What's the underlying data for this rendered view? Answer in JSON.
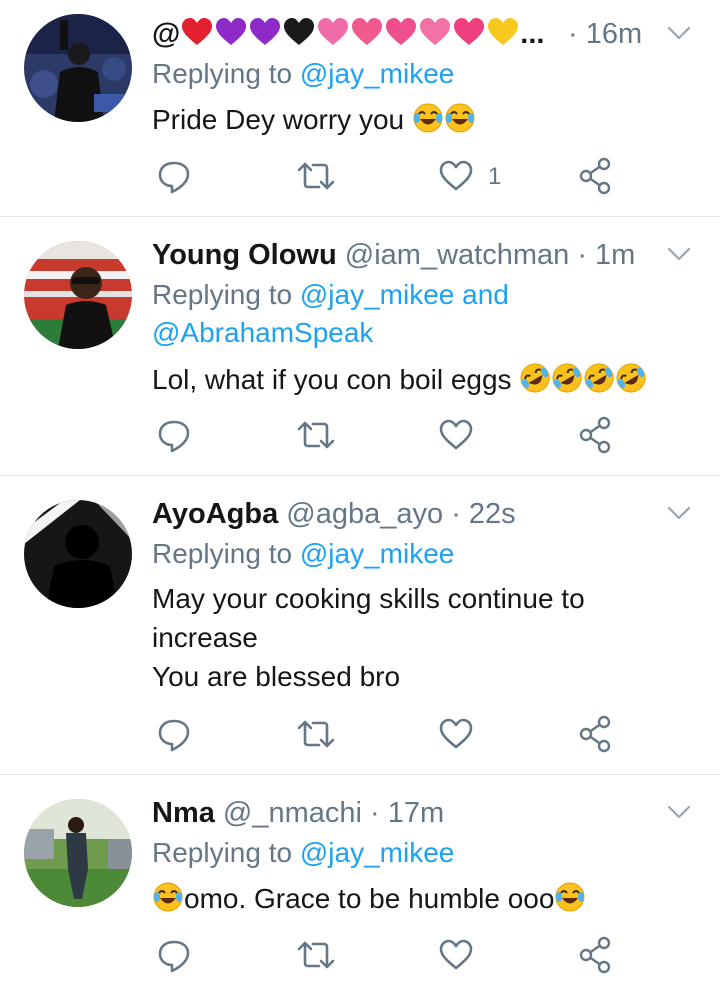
{
  "tweets": [
    {
      "name": "@",
      "handle": "",
      "time": "· 16m",
      "name_emojis": [
        "red-heart",
        "purple-heart",
        "purple-heart",
        "black-heart",
        "sparkling-heart",
        "heart-with-ribbon",
        "two-hearts",
        "revolving-hearts",
        "growing-heart",
        "yellow-heart"
      ],
      "ellipsis": "...",
      "replying_prefix": "Replying to",
      "replying_mentions": [
        "@jay_mikee"
      ],
      "replying_and": "",
      "text_lines": [
        "Pride Dey worry you"
      ],
      "like_count": "1"
    },
    {
      "name": "Young Olowu",
      "handle": "@iam_watchman",
      "time": "· 1m",
      "replying_prefix": "Replying to",
      "replying_mentions": [
        "@jay_mikee",
        "@AbrahamSpeak"
      ],
      "replying_and": "and",
      "text_lines": [
        "Lol, what if you con boil eggs"
      ],
      "like_count": ""
    },
    {
      "name": "AyoAgba",
      "handle": "@agba_ayo",
      "time": "· 22s",
      "replying_prefix": "Replying to",
      "replying_mentions": [
        "@jay_mikee"
      ],
      "replying_and": "",
      "text_lines": [
        "May your cooking skills continue to",
        "increase",
        "You are blessed bro"
      ],
      "like_count": ""
    },
    {
      "name": "Nma",
      "handle": "@_nmachi",
      "time": "· 17m",
      "replying_prefix": "Replying to",
      "replying_mentions": [
        "@jay_mikee"
      ],
      "replying_and": "",
      "text_lines": [
        "omo. Grace to be humble ooo"
      ],
      "like_count": ""
    }
  ],
  "icons": {
    "reply": "reply-icon",
    "retweet": "retweet-icon",
    "like": "heart-icon",
    "share": "share-icon",
    "more": "chevron-down-icon"
  },
  "colors": {
    "text": "#14171a",
    "secondary": "#657786",
    "link": "#1da1f2",
    "divider": "#e1e8ed",
    "icon": "#657786"
  }
}
